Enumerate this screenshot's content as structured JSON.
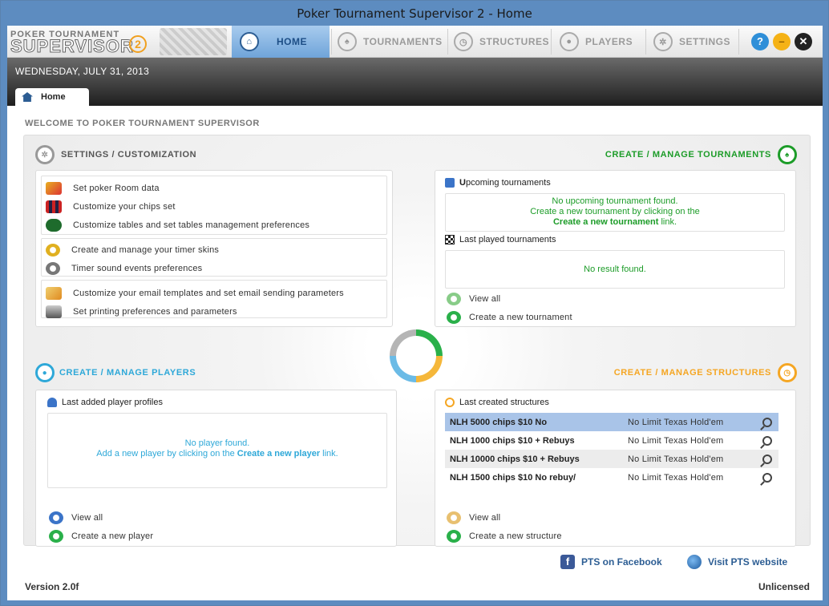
{
  "window": {
    "title": "Poker Tournament Supervisor 2 - Home"
  },
  "logo": {
    "line1": "POKER TOURNAMENT",
    "line2": "SUPERVISOR",
    "badge": "2"
  },
  "nav": {
    "tabs": [
      {
        "label": "HOME"
      },
      {
        "label": "TOURNAMENTS"
      },
      {
        "label": "STRUCTURES"
      },
      {
        "label": "PLAYERS"
      },
      {
        "label": "SETTINGS"
      }
    ],
    "help": "?",
    "minimize": "–",
    "close": "✕"
  },
  "date": "WEDNESDAY, JULY 31, 2013",
  "home_tab": "Home",
  "welcome": "WELCOME TO POKER TOURNAMENT SUPERVISOR",
  "settings": {
    "title": "SETTINGS / CUSTOMIZATION",
    "items": [
      "Set poker Room data",
      "Customize your chips set",
      "Customize tables and set tables management preferences",
      "Create and manage your timer skins",
      "Timer sound events preferences",
      "Customize your email templates and set email sending parameters",
      "Set printing preferences and parameters"
    ]
  },
  "tournaments": {
    "title": "CREATE / MANAGE TOURNAMENTS",
    "upcoming_header_bold": "U",
    "upcoming_header_rest": "pcoming tournaments",
    "upcoming_line1": "No upcoming tournament found.",
    "upcoming_line2": "Create a new tournament by clicking on the",
    "upcoming_link": "Create a new tournament",
    "upcoming_tail": " link.",
    "last_played_header": "Last played tournaments",
    "last_played_msg": "No result found.",
    "view_all": "View all",
    "create": "Create a new tournament"
  },
  "players": {
    "title": "CREATE / MANAGE PLAYERS",
    "header": "Last added player profiles",
    "msg_line1": "No player found.",
    "msg_line2_pre": "Add a new player by clicking on the ",
    "msg_link": "Create a new player",
    "msg_tail": " link.",
    "view_all": "View all",
    "create": "Create a new player"
  },
  "structures": {
    "title": "CREATE / MANAGE STRUCTURES",
    "header": "Last created structures",
    "rows": [
      {
        "name": "NLH 5000 chips $10 No",
        "type": "No Limit Texas Hold'em"
      },
      {
        "name": "NLH 1000 chips $10 + Rebuys",
        "type": "No Limit Texas Hold'em"
      },
      {
        "name": "NLH 10000 chips $10 + Rebuys",
        "type": "No Limit Texas Hold'em"
      },
      {
        "name": "NLH 1500 chips $10 No rebuy/",
        "type": "No Limit Texas Hold'em"
      }
    ],
    "view_all": "View all",
    "create": "Create a new structure"
  },
  "footer": {
    "facebook": "PTS on Facebook",
    "website": "Visit PTS website",
    "version": "Version 2.0f",
    "license": "Unlicensed"
  },
  "colors": {
    "green": "#1c9c28",
    "blue": "#2ea8d8",
    "orange": "#f5a623",
    "nav_active": "#6fa4d9"
  }
}
